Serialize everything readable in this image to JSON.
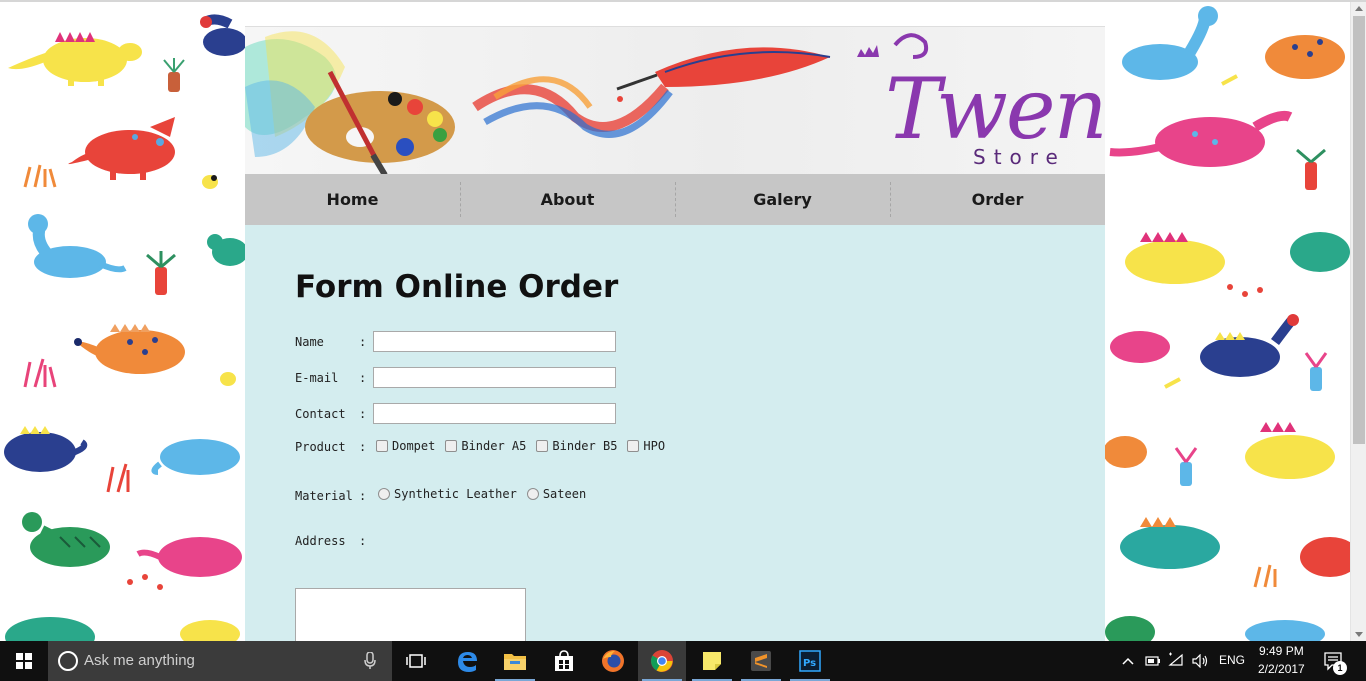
{
  "header": {
    "logo_text": "Twenty",
    "logo_subtext": "Store"
  },
  "nav": {
    "items": [
      "Home",
      "About",
      "Galery",
      "Order"
    ]
  },
  "form": {
    "title": "Form Online Order",
    "name_label": "Name",
    "email_label": "E-mail",
    "contact_label": "Contact",
    "product_label": "Product",
    "material_label": "Material",
    "address_label": "Address",
    "colon": ":",
    "name_value": "",
    "email_value": "",
    "contact_value": "",
    "address_value": "",
    "products": [
      "Dompet",
      "Binder A5",
      "Binder B5",
      "HPO"
    ],
    "materials": [
      "Synthetic Leather",
      "Sateen"
    ]
  },
  "taskbar": {
    "search_placeholder": "Ask me anything",
    "apps": [
      "task-view",
      "edge",
      "file-explorer",
      "store",
      "firefox",
      "chrome",
      "sticky-notes",
      "sublime-text",
      "photoshop"
    ],
    "active_app": "chrome",
    "language": "ENG",
    "time": "9:49 PM",
    "date": "2/2/2017",
    "notification_count": "1"
  },
  "colors": {
    "page_background": "#d4edef",
    "nav_background": "#c6c6c6",
    "logo": "#8a38ae",
    "taskbar": "#101010"
  }
}
